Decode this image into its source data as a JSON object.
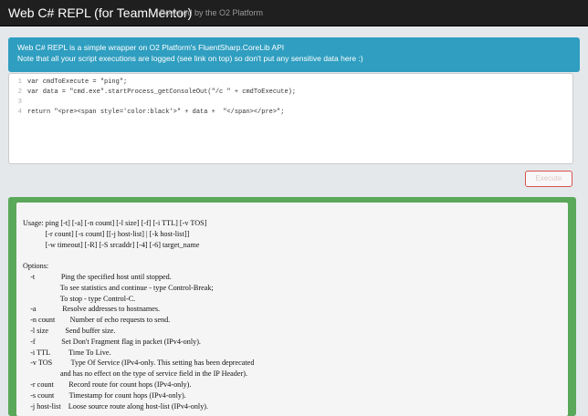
{
  "header": {
    "title": "Web C# REPL (for TeamMentor)",
    "subtitle": "Powered by the O2 Platform"
  },
  "info": {
    "line1": "Web C# REPL is a simple wrapper on O2 Platform's FluentSharp.CoreLib API",
    "line2": "Note that all your script executions are logged (see link on top) so don't put any sensitive data here :)"
  },
  "editor": {
    "lines": [
      {
        "n": "1",
        "code": "var cmdToExecute = \"ping\";"
      },
      {
        "n": "2",
        "code": "var data = \"cmd.exe\".startProcess_getConsoleOut(\"/c \" + cmdToExecute);"
      },
      {
        "n": "3",
        "code": ""
      },
      {
        "n": "4",
        "code": "return \"<pre><span style='color:black'>\" + data +  \"</span></pre>\";"
      }
    ]
  },
  "execute_label": "Execute",
  "output": {
    "lines": [
      "Usage: ping [-t] [-a] [-n count] [-l size] [-f] [-i TTL] [-v TOS]",
      "            [-r count] [-s count] [[-j host-list] | [-k host-list]]",
      "            [-w timeout] [-R] [-S srcaddr] [-4] [-6] target_name",
      "",
      "Options:",
      "    -t              Ping the specified host until stopped.",
      "                    To see statistics and continue - type Control-Break;",
      "                    To stop - type Control-C.",
      "    -a              Resolve addresses to hostnames.",
      "    -n count        Number of echo requests to send.",
      "    -l size         Send buffer size.",
      "    -f              Set Don't Fragment flag in packet (IPv4-only).",
      "    -i TTL          Time To Live.",
      "    -v TOS          Type Of Service (IPv4-only. This setting has been deprecated",
      "                    and has no effect on the type of service field in the IP Header).",
      "    -r count        Record route for count hops (IPv4-only).",
      "    -s count        Timestamp for count hops (IPv4-only).",
      "    -j host-list    Loose source route along host-list (IPv4-only)."
    ]
  }
}
